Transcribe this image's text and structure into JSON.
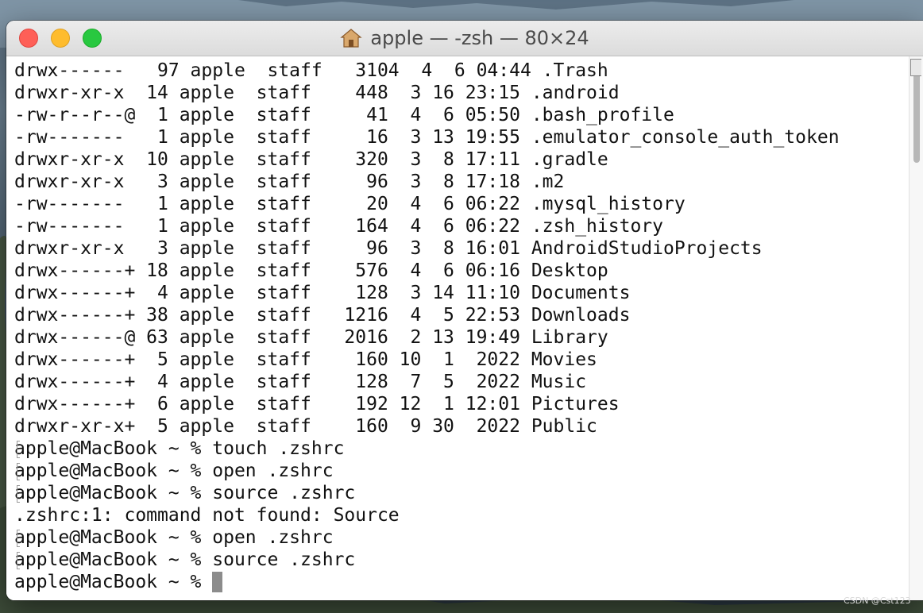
{
  "window": {
    "title": "apple — -zsh — 80×24",
    "title_icon": "home-folder-icon"
  },
  "terminal": {
    "listing": [
      "drwx------   97 apple  staff   3104  4  6 04:44 .Trash",
      "drwxr-xr-x  14 apple  staff    448  3 16 23:15 .android",
      "-rw-r--r--@  1 apple  staff     41  4  6 05:50 .bash_profile",
      "-rw-------   1 apple  staff     16  3 13 19:55 .emulator_console_auth_token",
      "drwxr-xr-x  10 apple  staff    320  3  8 17:11 .gradle",
      "drwxr-xr-x   3 apple  staff     96  3  8 17:18 .m2",
      "-rw-------   1 apple  staff     20  4  6 06:22 .mysql_history",
      "-rw-------   1 apple  staff    164  4  6 06:22 .zsh_history",
      "drwxr-xr-x   3 apple  staff     96  3  8 16:01 AndroidStudioProjects",
      "drwx------+ 18 apple  staff    576  4  6 06:16 Desktop",
      "drwx------+  4 apple  staff    128  3 14 11:10 Documents",
      "drwx------+ 38 apple  staff   1216  4  5 22:53 Downloads",
      "drwx------@ 63 apple  staff   2016  2 13 19:49 Library",
      "drwx------+  5 apple  staff    160 10  1  2022 Movies",
      "drwx------+  4 apple  staff    128  7  5  2022 Music",
      "drwx------+  6 apple  staff    192 12  1 12:01 Pictures",
      "drwxr-xr-x+  5 apple  staff    160  9 30  2022 Public"
    ],
    "history": [
      {
        "text": "apple@MacBook ~ % touch .zshrc",
        "marked": true
      },
      {
        "text": "apple@MacBook ~ % open .zshrc",
        "marked": true
      },
      {
        "text": "apple@MacBook ~ % source .zshrc",
        "marked": true
      },
      {
        "text": ".zshrc:1: command not found: Source",
        "marked": false
      },
      {
        "text": "apple@MacBook ~ % open .zshrc",
        "marked": true
      },
      {
        "text": "apple@MacBook ~ % source .zshrc",
        "marked": true
      }
    ],
    "prompt": "apple@MacBook ~ % "
  },
  "watermark": "CSDN @Cst123"
}
